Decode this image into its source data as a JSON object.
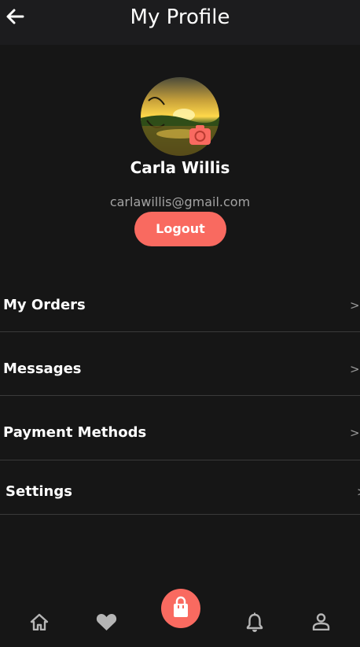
{
  "header": {
    "title": "My Profile"
  },
  "profile": {
    "name": "Carla Willis",
    "email": "carlawillis@gmail.com",
    "logout_label": "Logout"
  },
  "menu": {
    "items": [
      {
        "label": "My Orders",
        "chevron": ">"
      },
      {
        "label": "Messages",
        "chevron": ">"
      },
      {
        "label": "Payment Methods",
        "chevron": ">"
      },
      {
        "label": "Settings",
        "chevron": ">"
      }
    ]
  },
  "tabs": [
    "home-icon",
    "heart-icon",
    "shopping-bag-icon",
    "bell-icon",
    "user-icon"
  ],
  "colors": {
    "accent": "#f96a60",
    "background": "#161616",
    "header": "#1c1c1e"
  }
}
